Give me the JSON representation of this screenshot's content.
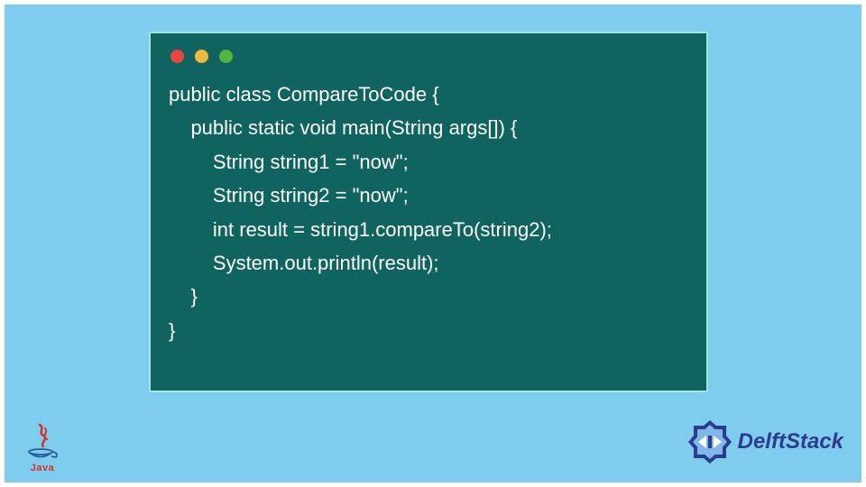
{
  "code": {
    "lines": [
      "public class CompareToCode {",
      "    public static void main(String args[]) {",
      "        String string1 = \"now\";",
      "        String string2 = \"now\";",
      "        int result = string1.compareTo(string2);",
      "        System.out.println(result);",
      "    }",
      "}"
    ]
  },
  "logos": {
    "java_label": "Java",
    "delft_label": "DelftStack"
  },
  "colors": {
    "background": "#7fcdee",
    "window_bg": "#0f6460",
    "window_border": "#9fe6e1",
    "dot_red": "#ed4340",
    "dot_yellow": "#f0b83e",
    "dot_green": "#52b53f",
    "java_red": "#d6302a",
    "java_blue": "#2a5c9e",
    "delft_blue": "#2d3b8f"
  }
}
